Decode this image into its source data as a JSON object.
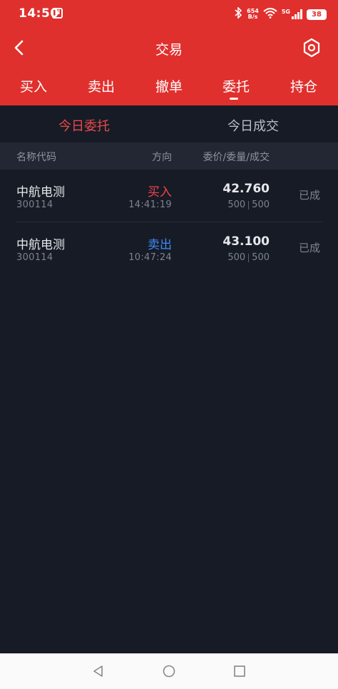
{
  "statusbar": {
    "time": "14:50",
    "nfc_icon": "N",
    "net_speed_value": "654",
    "net_speed_unit": "B/s",
    "network_type": "5G",
    "battery": "38"
  },
  "appbar": {
    "title": "交易"
  },
  "tabs": [
    {
      "label": "买入"
    },
    {
      "label": "卖出"
    },
    {
      "label": "撤单"
    },
    {
      "label": "委托"
    },
    {
      "label": "持仓"
    }
  ],
  "active_tab": "委托",
  "subtabs": {
    "today_orders": "今日委托",
    "today_trades": "今日成交"
  },
  "columns": {
    "name_code": "名称代码",
    "direction": "方向",
    "price_qty_fill": "委价/委量/成交"
  },
  "orders": [
    {
      "name": "中航电测",
      "code": "300114",
      "direction": "买入",
      "time": "14:41:19",
      "price": "42.760",
      "qty": "500",
      "filled": "500",
      "status": "已成"
    },
    {
      "name": "中航电测",
      "code": "300114",
      "direction": "卖出",
      "time": "10:47:24",
      "price": "43.100",
      "qty": "500",
      "filled": "500",
      "status": "已成"
    }
  ],
  "colors": {
    "brand_red": "#e0302d",
    "buy": "#f0434a",
    "sell": "#3d8af7",
    "background": "#171b25"
  },
  "icons": [
    "back-icon",
    "settings-icon",
    "bluetooth-icon",
    "wifi-icon",
    "signal-icon",
    "battery-icon",
    "nav-back-icon",
    "nav-home-icon",
    "nav-recents-icon"
  ]
}
